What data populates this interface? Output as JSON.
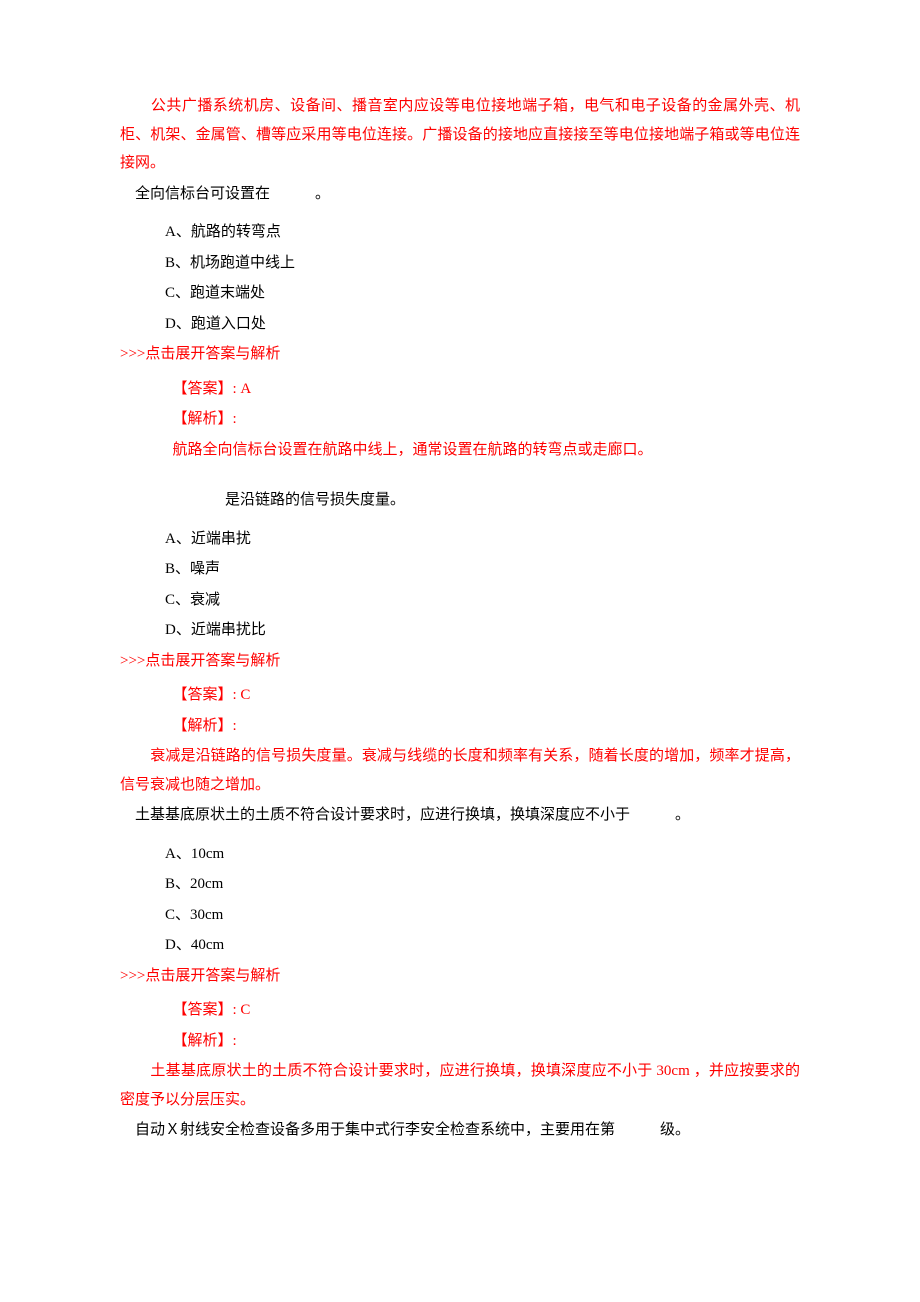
{
  "intro": "　　公共广播系统机房、设备间、播音室内应设等电位接地端子箱，电气和电子设备的金属外壳、机柜、机架、金属管、槽等应采用等电位连接。广播设备的接地应直接接至等电位接地端子箱或等电位连接网。",
  "expand_label": ">>>点击展开答案与解析",
  "ans_label": "【答案】:",
  "exp_label": "【解析】:",
  "q1": {
    "stem": "全向信标台可设置在　　　。",
    "A": "A、航路的转弯点",
    "B": "B、机场跑道中线上",
    "C": "C、跑道末端处",
    "D": "D、跑道入口处",
    "answer": " A",
    "explain": "航路全向信标台设置在航路中线上，通常设置在航路的转弯点或走廊口。"
  },
  "q2": {
    "stem": "　　　是沿链路的信号损失度量。",
    "A": "A、近端串扰",
    "B": "B、噪声",
    "C": "C、衰减",
    "D": "D、近端串扰比",
    "answer": " C",
    "explain": "　　衰减是沿链路的信号损失度量。衰减与线缆的长度和频率有关系，随着长度的增加，频率才提高，信号衰减也随之增加。"
  },
  "q3": {
    "stem": "土基基底原状土的土质不符合设计要求时，应进行换填，换填深度应不小于　　　。",
    "A": "A、10cm",
    "B": "B、20cm",
    "C": "C、30cm",
    "D": "D、40cm",
    "answer": " C",
    "explain": "　　土基基底原状土的土质不符合设计要求时，应进行换填，换填深度应不小于 30cm ，并应按要求的密度予以分层压实。"
  },
  "q4": {
    "stem": "自动Ｘ射线安全检查设备多用于集中式行李安全检查系统中，主要用在第　　　级。"
  }
}
